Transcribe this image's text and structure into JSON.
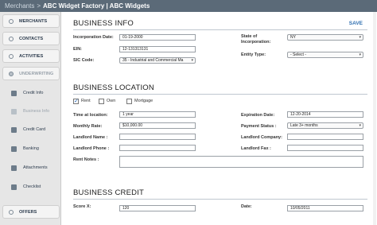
{
  "header": {
    "root": "Merchants",
    "separator": ">",
    "title": "ABC Widget Factory | ABC Widgets"
  },
  "sidebar": {
    "items": [
      {
        "label": "MERCHANTS",
        "icon": "merchants-icon",
        "type": "top"
      },
      {
        "label": "CONTACTS",
        "icon": "contacts-icon",
        "type": "top"
      },
      {
        "label": "ACTIVITIES",
        "icon": "activities-icon",
        "type": "top"
      },
      {
        "label": "UNDERWRITING",
        "icon": "underwriting-icon",
        "type": "top-disabled"
      },
      {
        "label": "Credit Info",
        "icon": "credit-info-icon",
        "type": "sub"
      },
      {
        "label": "Business Info",
        "icon": "business-info-icon",
        "type": "sub-disabled"
      },
      {
        "label": "Credit Card",
        "icon": "home-icon",
        "type": "sub"
      },
      {
        "label": "Banking",
        "icon": "bank-icon",
        "type": "sub"
      },
      {
        "label": "Attachments",
        "icon": "paperclip-icon",
        "type": "sub"
      },
      {
        "label": "Checklist",
        "icon": "checklist-icon",
        "type": "sub"
      },
      {
        "label": "OFFERS",
        "icon": "offers-icon",
        "type": "top"
      }
    ]
  },
  "business_info": {
    "title": "BUSINESS INFO",
    "save_label": "SAVE",
    "incorporation_date_label": "Incorporation Date:",
    "incorporation_date": "01-19-2000",
    "ein_label": "EIN:",
    "ein": "12-131313131",
    "sic_code_label": "SIC Code:",
    "sic_code": "35 - Industrial and Commercial Ma",
    "state_label": "State of Incorporation:",
    "state": "NY",
    "entity_type_label": "Entity Type:",
    "entity_type": "- Select -"
  },
  "business_location": {
    "title": "BUSINESS LOCATION",
    "rent_label": "Rent",
    "rent_checked": true,
    "own_label": "Own",
    "own_checked": false,
    "mortgage_label": "Mortgage",
    "mortgage_checked": false,
    "time_at_location_label": "Time at location:",
    "time_at_location": "1 year",
    "monthly_rate_label": "Monthly Rate:",
    "monthly_rate": "$10,000.00",
    "landlord_name_label": "Landlord Name :",
    "landlord_name": "",
    "landlord_phone_label": "Landlord Phone :",
    "landlord_phone": "",
    "rent_notes_label": "Rent Notes :",
    "rent_notes": "",
    "expiration_date_label": "Expiration Date:",
    "expiration_date": "12-20-2014",
    "payment_status_label": "Payment Status :",
    "payment_status": "Late 3+ months",
    "landlord_company_label": "Landlord Company:",
    "landlord_company": "",
    "landlord_fax_label": "Landlord Fax :",
    "landlord_fax": ""
  },
  "business_credit": {
    "title": "BUSINESS CREDIT",
    "score_label": "Score X:",
    "score": "120",
    "date_label": "Date:",
    "date": "10/05/2011"
  },
  "colors": {
    "topbar": "#5b6a78",
    "sidebar": "#e6e6e6",
    "link": "#2f6fb0"
  }
}
